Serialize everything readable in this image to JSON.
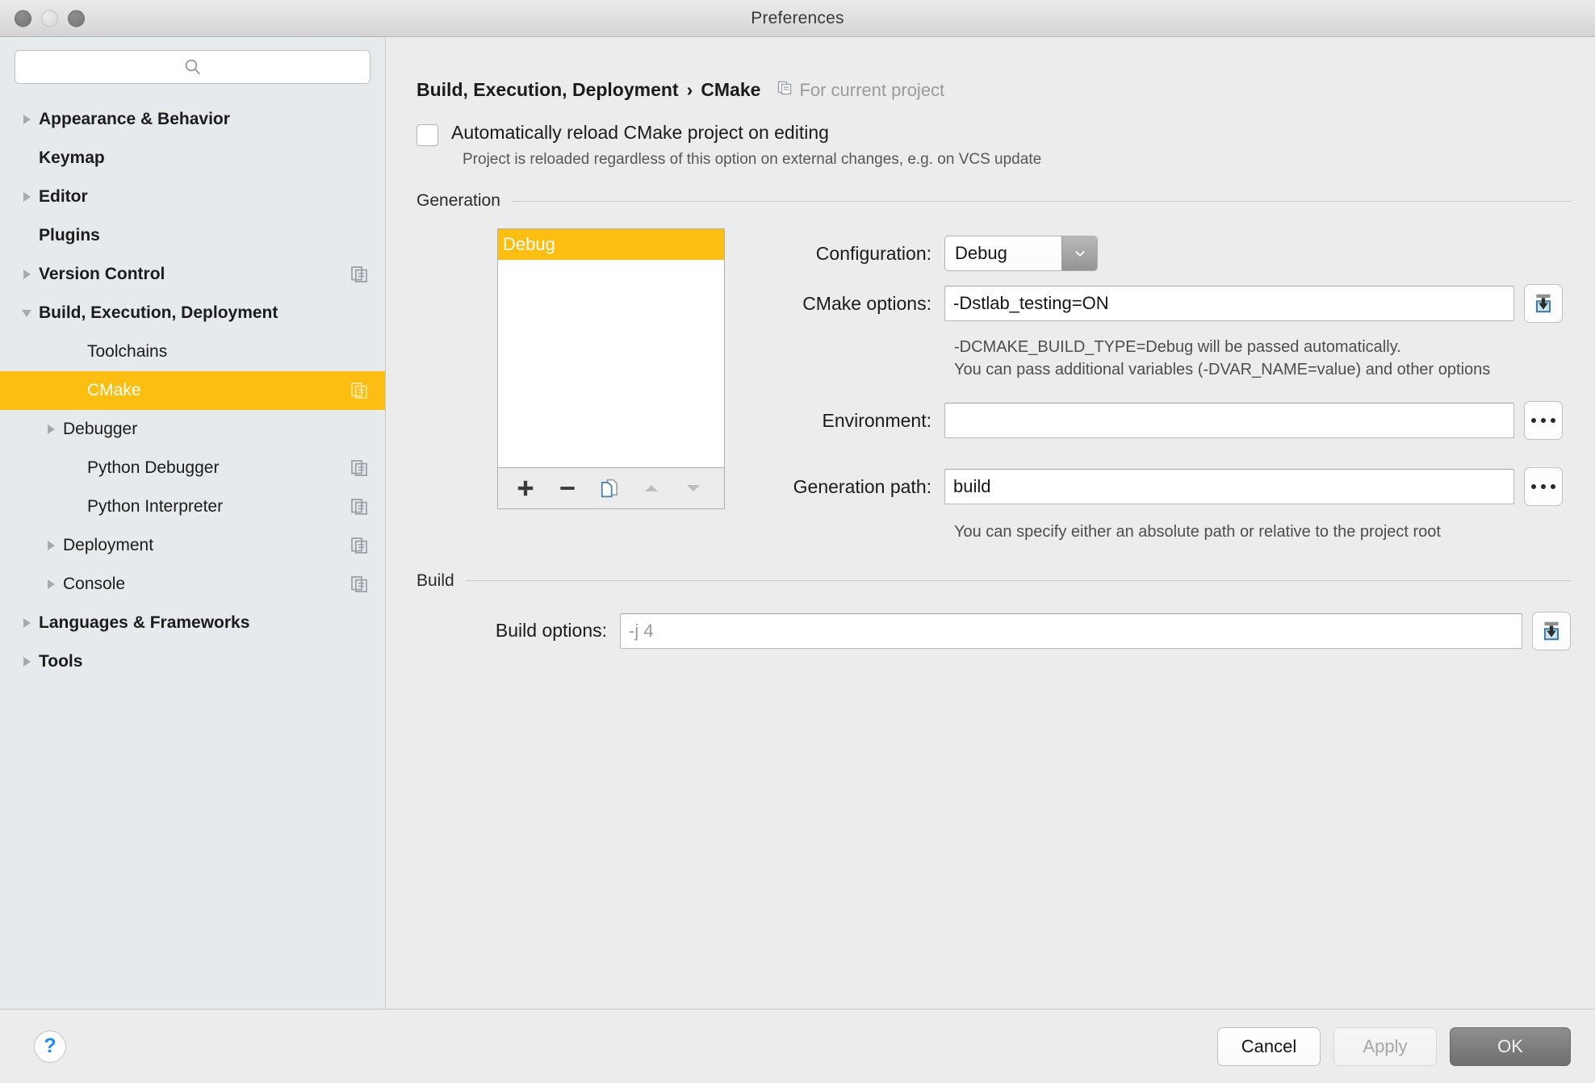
{
  "window": {
    "title": "Preferences",
    "traffic_lights": [
      "close-button",
      "minimize-button",
      "zoom-button"
    ]
  },
  "sidebar": {
    "search": {
      "placeholder": "",
      "value": ""
    },
    "items": [
      {
        "label": "Appearance & Behavior",
        "level": 0,
        "bold": true,
        "twisty": "collapsed",
        "copy_icon": false,
        "selected": false
      },
      {
        "label": "Keymap",
        "level": 0,
        "bold": true,
        "twisty": "none",
        "copy_icon": false,
        "selected": false
      },
      {
        "label": "Editor",
        "level": 0,
        "bold": true,
        "twisty": "collapsed",
        "copy_icon": false,
        "selected": false
      },
      {
        "label": "Plugins",
        "level": 0,
        "bold": true,
        "twisty": "none",
        "copy_icon": false,
        "selected": false
      },
      {
        "label": "Version Control",
        "level": 0,
        "bold": true,
        "twisty": "collapsed",
        "copy_icon": true,
        "selected": false
      },
      {
        "label": "Build, Execution, Deployment",
        "level": 0,
        "bold": true,
        "twisty": "expanded",
        "copy_icon": false,
        "selected": false
      },
      {
        "label": "Toolchains",
        "level": 1,
        "bold": false,
        "twisty": "none",
        "copy_icon": false,
        "selected": false
      },
      {
        "label": "CMake",
        "level": 1,
        "bold": false,
        "twisty": "none",
        "copy_icon": true,
        "selected": true
      },
      {
        "label": "Debugger",
        "level": 1,
        "bold": false,
        "twisty": "collapsed",
        "copy_icon": false,
        "selected": false
      },
      {
        "label": "Python Debugger",
        "level": 1,
        "bold": false,
        "twisty": "none",
        "copy_icon": true,
        "selected": false
      },
      {
        "label": "Python Interpreter",
        "level": 1,
        "bold": false,
        "twisty": "none",
        "copy_icon": true,
        "selected": false
      },
      {
        "label": "Deployment",
        "level": 1,
        "bold": false,
        "twisty": "collapsed",
        "copy_icon": true,
        "selected": false
      },
      {
        "label": "Console",
        "level": 1,
        "bold": false,
        "twisty": "collapsed",
        "copy_icon": true,
        "selected": false
      },
      {
        "label": "Languages & Frameworks",
        "level": 0,
        "bold": true,
        "twisty": "collapsed",
        "copy_icon": false,
        "selected": false
      },
      {
        "label": "Tools",
        "level": 0,
        "bold": true,
        "twisty": "collapsed",
        "copy_icon": false,
        "selected": false
      }
    ]
  },
  "content": {
    "breadcrumb": {
      "parent": "Build, Execution, Deployment",
      "separator": "›",
      "current": "CMake",
      "scope": "For current project"
    },
    "auto_reload": {
      "label": "Automatically reload CMake project on editing",
      "checked": false,
      "note": "Project is reloaded regardless of this option on external changes, e.g. on VCS update"
    },
    "generation": {
      "title": "Generation",
      "profiles": [
        "Debug"
      ],
      "selected_profile": "Debug",
      "toolbar": [
        "add-icon",
        "remove-icon",
        "copy-icon",
        "move-up-icon",
        "move-down-icon"
      ],
      "configuration": {
        "label": "Configuration:",
        "value": "Debug"
      },
      "cmake_options": {
        "label": "CMake options:",
        "value": "-Dstlab_testing=ON",
        "hint_line1": "-DCMAKE_BUILD_TYPE=Debug will be passed automatically.",
        "hint_line2": "You can pass additional variables (-DVAR_NAME=value) and other options"
      },
      "environment": {
        "label": "Environment:",
        "value": "",
        "browse": "..."
      },
      "generation_path": {
        "label": "Generation path:",
        "value": "build",
        "browse": "...",
        "hint": "You can specify either an absolute path or relative to the project root"
      }
    },
    "build": {
      "title": "Build",
      "build_options": {
        "label": "Build options:",
        "value": "",
        "placeholder": "-j 4"
      }
    }
  },
  "footer": {
    "help": "?",
    "cancel": "Cancel",
    "apply": "Apply",
    "ok": "OK"
  },
  "colors": {
    "selection": "#fcbe10",
    "sidebar_bg": "#e6eaed",
    "content_bg": "#ececec",
    "accent_blue": "#1a8cff"
  }
}
